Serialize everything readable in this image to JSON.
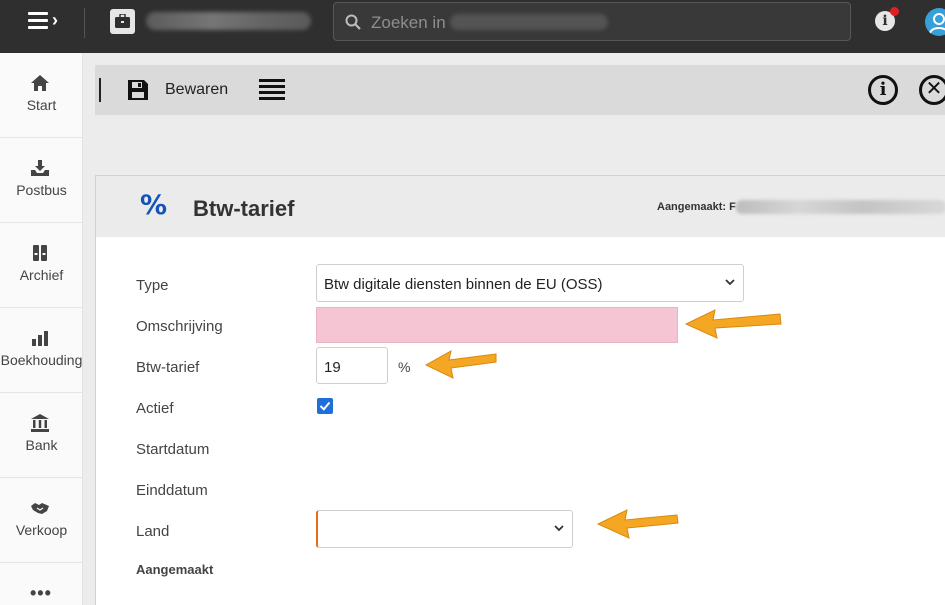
{
  "topbar": {
    "search_placeholder": "Zoeken in",
    "info_label": "i"
  },
  "sidebar": {
    "items": [
      {
        "label": "Start",
        "icon": "home-icon"
      },
      {
        "label": "Postbus",
        "icon": "inbox-icon"
      },
      {
        "label": "Archief",
        "icon": "archive-icon"
      },
      {
        "label": "Boekhouding",
        "icon": "bar-chart-icon"
      },
      {
        "label": "Bank",
        "icon": "bank-icon"
      },
      {
        "label": "Verkoop",
        "icon": "handshake-icon"
      }
    ],
    "more_label": "•••"
  },
  "toolbar": {
    "save_label": "Bewaren",
    "info_label": "i",
    "close_label": "✕"
  },
  "panel": {
    "icon_glyph": "%",
    "title": "Btw-tarief",
    "created_top_label": "Aangemaakt: F"
  },
  "form": {
    "type_label": "Type",
    "type_value": "Btw digitale diensten binnen de EU (OSS)",
    "omschrijving_label": "Omschrijving",
    "omschrijving_value": "",
    "btw_label": "Btw-tarief",
    "btw_value": "19",
    "btw_unit": "%",
    "actief_label": "Actief",
    "actief_checked": true,
    "startdatum_label": "Startdatum",
    "einddatum_label": "Einddatum",
    "land_label": "Land",
    "land_value": "",
    "aangemaakt_label": "Aangemaakt"
  },
  "colors": {
    "topbar_bg": "#2f2f2f",
    "accent_blue": "#1453b8",
    "checkbox_blue": "#1e6fd9",
    "required_pink": "#f6c5d3",
    "arrow_orange": "#f5a623"
  }
}
